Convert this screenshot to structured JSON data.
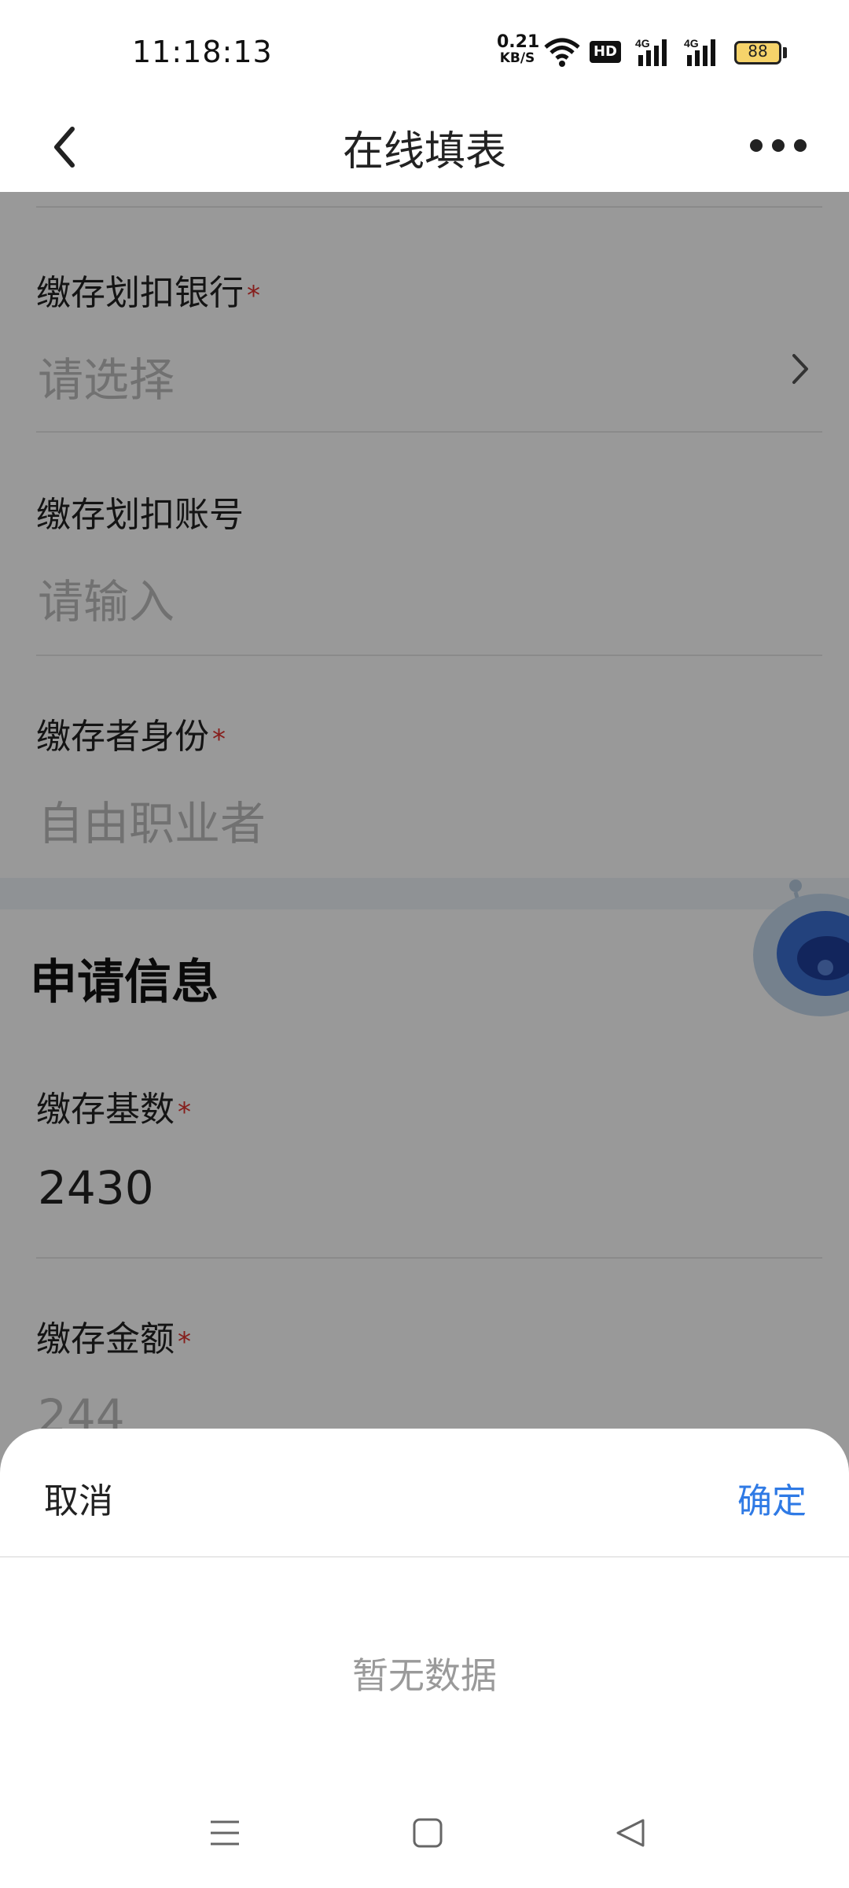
{
  "status_bar": {
    "time": "11:18:13",
    "net_speed_value": "0.21",
    "net_speed_unit": "KB/S",
    "hd_label": "HD",
    "battery_level": "88",
    "icons": [
      "wifi-icon",
      "hd-icon",
      "signal-4g-icon",
      "signal-4g-icon",
      "battery-icon"
    ]
  },
  "nav": {
    "title": "在线填表",
    "back_icon": "chevron-left-icon",
    "more_icon": "more-dots-icon"
  },
  "form": {
    "bank": {
      "label": "缴存划扣银行",
      "required_mark": "*",
      "value": "请选择"
    },
    "account": {
      "label": "缴存划扣账号",
      "value": "请输入"
    },
    "identity": {
      "label": "缴存者身份",
      "required_mark": "*",
      "value": "自由职业者"
    }
  },
  "apply_section": {
    "title": "申请信息",
    "base": {
      "label": "缴存基数",
      "required_mark": "*",
      "value": "2430"
    },
    "amount": {
      "label": "缴存金额",
      "required_mark": "*",
      "value": "244"
    }
  },
  "sheet": {
    "cancel_label": "取消",
    "confirm_label": "确定",
    "empty_text": "暂无数据"
  },
  "colors": {
    "accent": "#2f7ae5",
    "required": "#e0322f",
    "battery_fill": "#f6d36a"
  },
  "system_nav": [
    "menu-icon",
    "home-icon",
    "back-icon"
  ]
}
